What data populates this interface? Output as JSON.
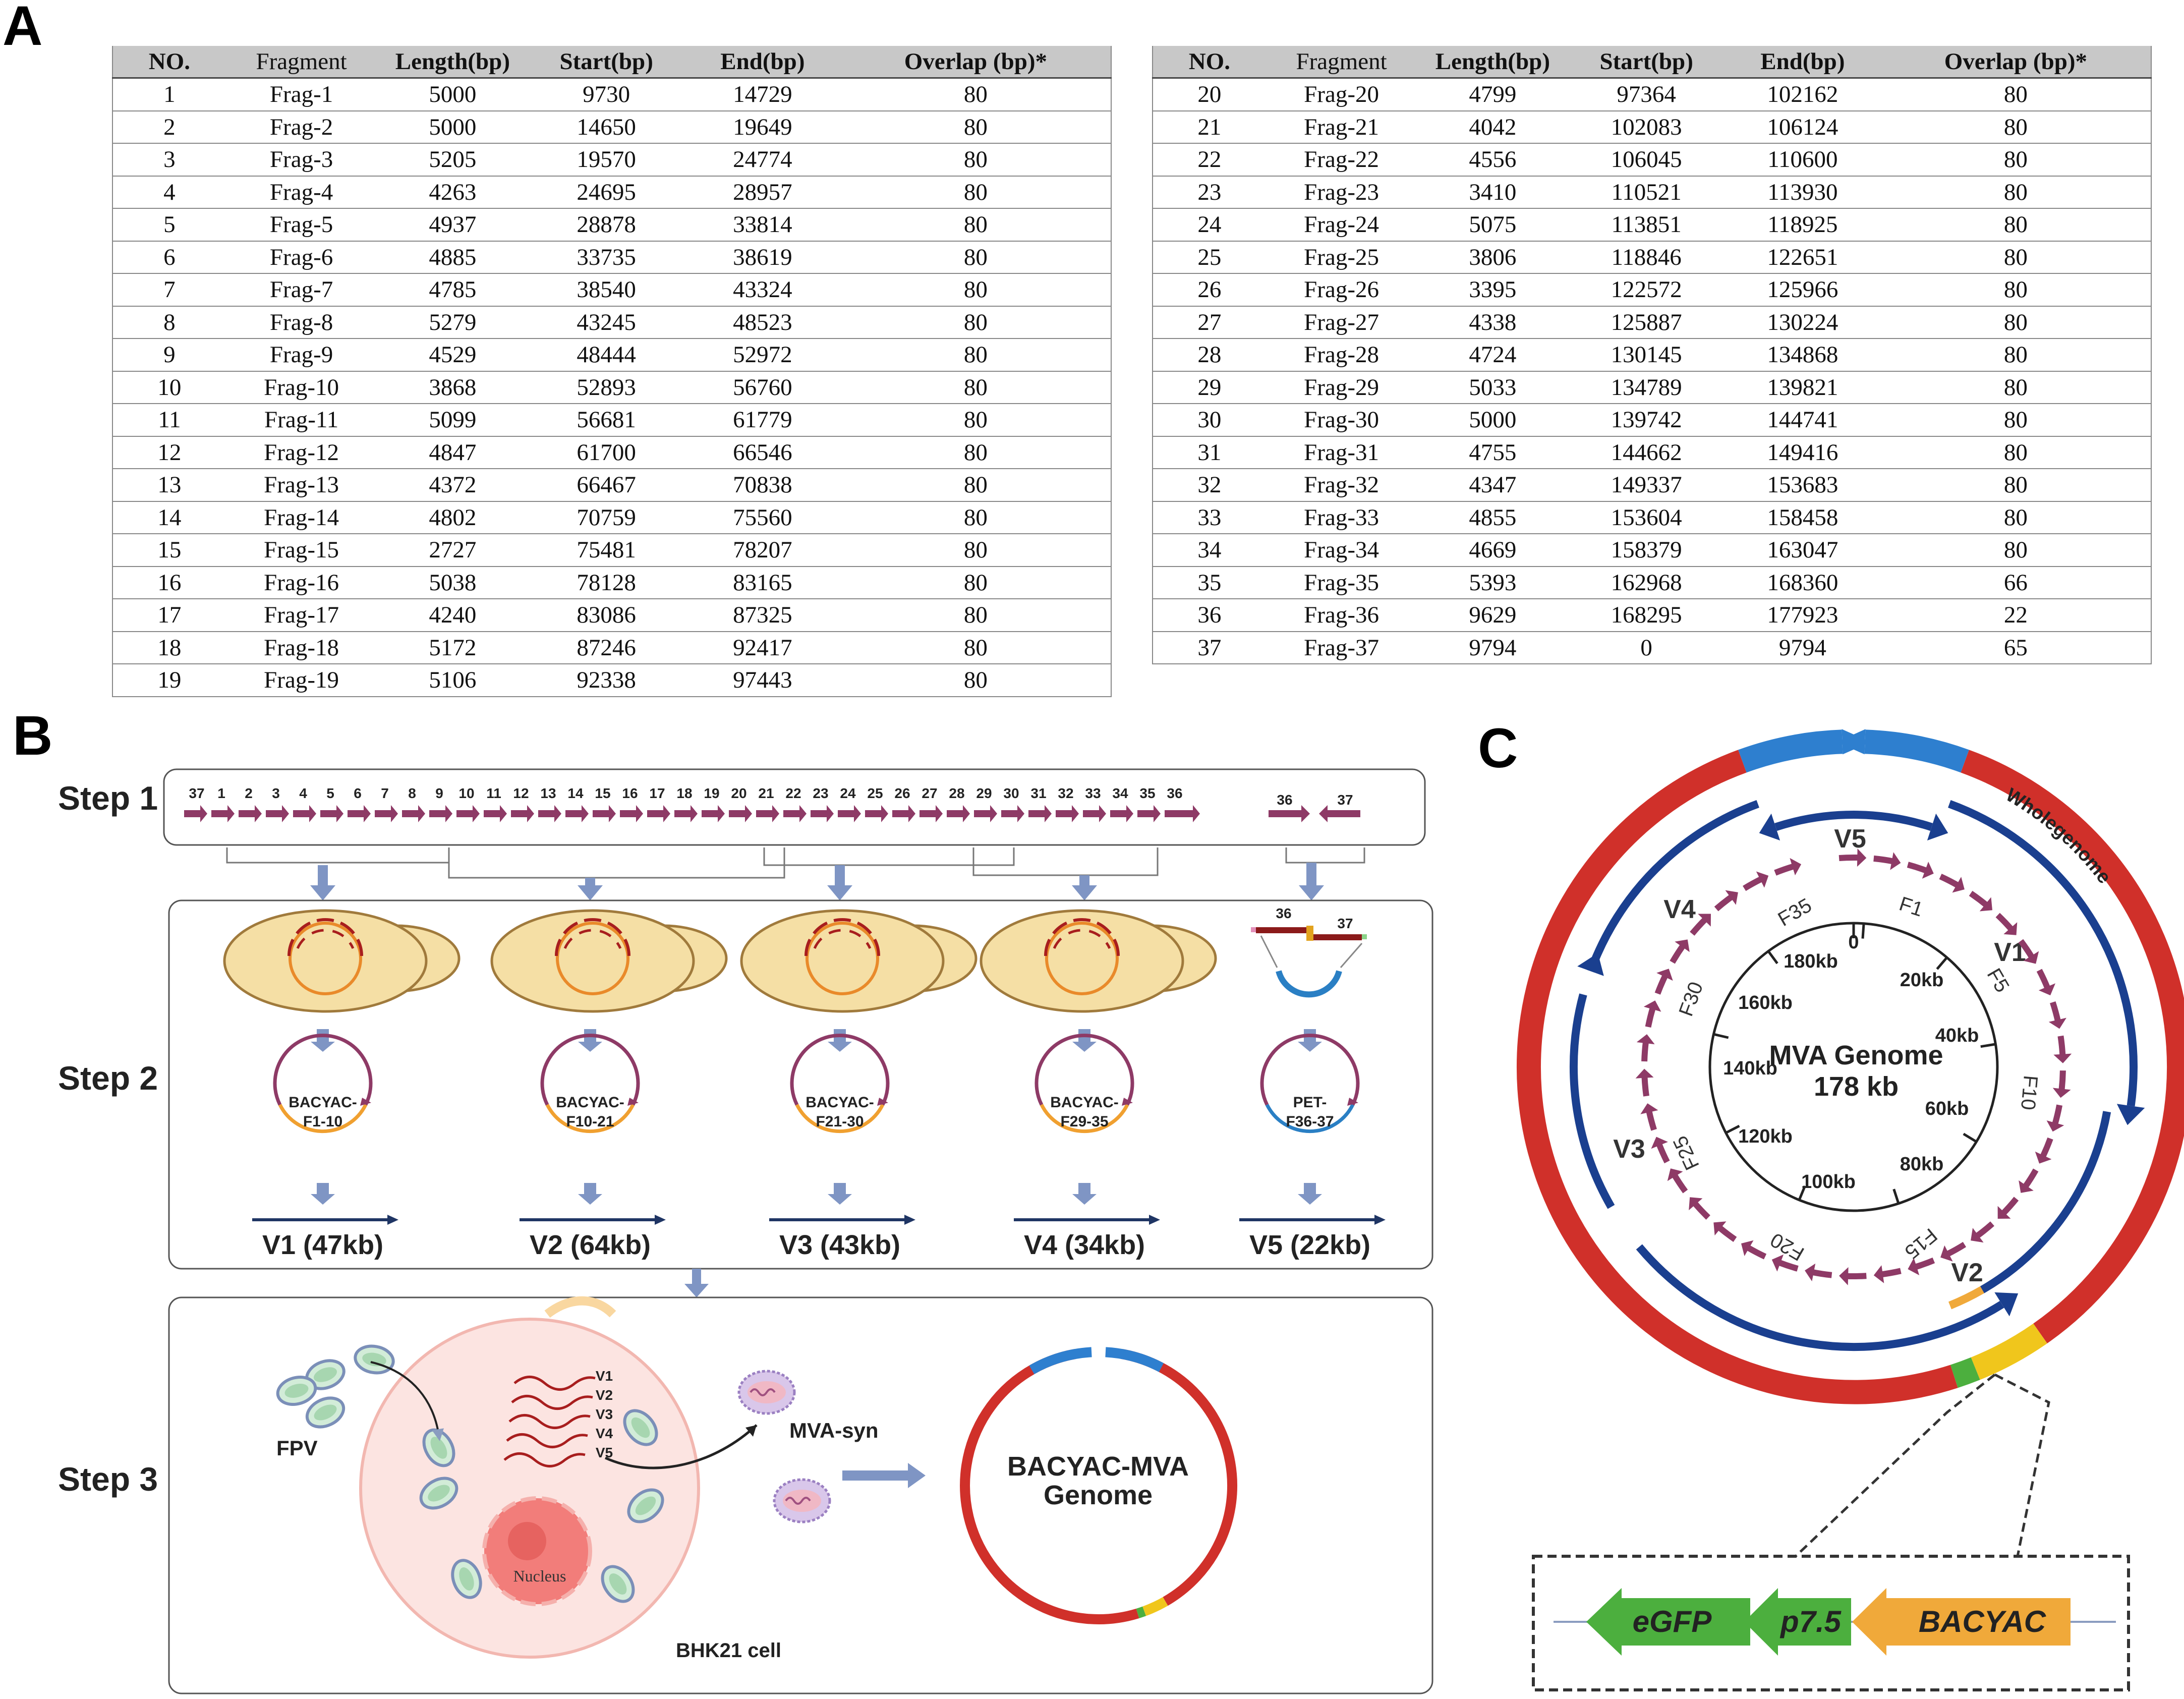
{
  "panels": {
    "a": "A",
    "b": "B",
    "c": "C"
  },
  "table": {
    "headers": [
      "NO.",
      "Fragment",
      "Length(bp)",
      "Start(bp)",
      "End(bp)",
      "Overlap (bp)*"
    ],
    "left_rows": [
      [
        "1",
        "Frag-1",
        "5000",
        "9730",
        "14729",
        "80"
      ],
      [
        "2",
        "Frag-2",
        "5000",
        "14650",
        "19649",
        "80"
      ],
      [
        "3",
        "Frag-3",
        "5205",
        "19570",
        "24774",
        "80"
      ],
      [
        "4",
        "Frag-4",
        "4263",
        "24695",
        "28957",
        "80"
      ],
      [
        "5",
        "Frag-5",
        "4937",
        "28878",
        "33814",
        "80"
      ],
      [
        "6",
        "Frag-6",
        "4885",
        "33735",
        "38619",
        "80"
      ],
      [
        "7",
        "Frag-7",
        "4785",
        "38540",
        "43324",
        "80"
      ],
      [
        "8",
        "Frag-8",
        "5279",
        "43245",
        "48523",
        "80"
      ],
      [
        "9",
        "Frag-9",
        "4529",
        "48444",
        "52972",
        "80"
      ],
      [
        "10",
        "Frag-10",
        "3868",
        "52893",
        "56760",
        "80"
      ],
      [
        "11",
        "Frag-11",
        "5099",
        "56681",
        "61779",
        "80"
      ],
      [
        "12",
        "Frag-12",
        "4847",
        "61700",
        "66546",
        "80"
      ],
      [
        "13",
        "Frag-13",
        "4372",
        "66467",
        "70838",
        "80"
      ],
      [
        "14",
        "Frag-14",
        "4802",
        "70759",
        "75560",
        "80"
      ],
      [
        "15",
        "Frag-15",
        "2727",
        "75481",
        "78207",
        "80"
      ],
      [
        "16",
        "Frag-16",
        "5038",
        "78128",
        "83165",
        "80"
      ],
      [
        "17",
        "Frag-17",
        "4240",
        "83086",
        "87325",
        "80"
      ],
      [
        "18",
        "Frag-18",
        "5172",
        "87246",
        "92417",
        "80"
      ],
      [
        "19",
        "Frag-19",
        "5106",
        "92338",
        "97443",
        "80"
      ]
    ],
    "right_rows": [
      [
        "20",
        "Frag-20",
        "4799",
        "97364",
        "102162",
        "80"
      ],
      [
        "21",
        "Frag-21",
        "4042",
        "102083",
        "106124",
        "80"
      ],
      [
        "22",
        "Frag-22",
        "4556",
        "106045",
        "110600",
        "80"
      ],
      [
        "23",
        "Frag-23",
        "3410",
        "110521",
        "113930",
        "80"
      ],
      [
        "24",
        "Frag-24",
        "5075",
        "113851",
        "118925",
        "80"
      ],
      [
        "25",
        "Frag-25",
        "3806",
        "118846",
        "122651",
        "80"
      ],
      [
        "26",
        "Frag-26",
        "3395",
        "122572",
        "125966",
        "80"
      ],
      [
        "27",
        "Frag-27",
        "4338",
        "125887",
        "130224",
        "80"
      ],
      [
        "28",
        "Frag-28",
        "4724",
        "130145",
        "134868",
        "80"
      ],
      [
        "29",
        "Frag-29",
        "5033",
        "134789",
        "139821",
        "80"
      ],
      [
        "30",
        "Frag-30",
        "5000",
        "139742",
        "144741",
        "80"
      ],
      [
        "31",
        "Frag-31",
        "4755",
        "144662",
        "149416",
        "80"
      ],
      [
        "32",
        "Frag-32",
        "4347",
        "149337",
        "153683",
        "80"
      ],
      [
        "33",
        "Frag-33",
        "4855",
        "153604",
        "158458",
        "80"
      ],
      [
        "34",
        "Frag-34",
        "4669",
        "158379",
        "163047",
        "80"
      ],
      [
        "35",
        "Frag-35",
        "5393",
        "162968",
        "168360",
        "66"
      ],
      [
        "36",
        "Frag-36",
        "9629",
        "168295",
        "177923",
        "22"
      ],
      [
        "37",
        "Frag-37",
        "9794",
        "0",
        "9794",
        "65"
      ]
    ]
  },
  "workflow": {
    "step1": "Step 1",
    "step2": "Step 2",
    "step3": "Step 3",
    "fragment_numbers": [
      "37",
      "1",
      "2",
      "3",
      "4",
      "5",
      "6",
      "7",
      "8",
      "9",
      "10",
      "11",
      "12",
      "13",
      "14",
      "15",
      "16",
      "17",
      "18",
      "19",
      "20",
      "21",
      "22",
      "23",
      "24",
      "25",
      "26",
      "27",
      "28",
      "29",
      "30",
      "31",
      "32",
      "33",
      "34",
      "35",
      "36"
    ],
    "v5_fragments": [
      "36",
      "37"
    ],
    "pet_labels": [
      "36",
      "37"
    ],
    "plasmids": [
      {
        "line1": "BACYAC-",
        "line2": "F1-10",
        "version": "V1 (47kb)"
      },
      {
        "line1": "BACYAC-",
        "line2": "F10-21",
        "version": "V2 (64kb)"
      },
      {
        "line1": "BACYAC-",
        "line2": "F21-30",
        "version": "V3 (43kb)"
      },
      {
        "line1": "BACYAC-",
        "line2": "F29-35",
        "version": "V4 (34kb)"
      },
      {
        "line1": "PET-",
        "line2": "F36-37",
        "version": "V5 (22kb)"
      }
    ],
    "fpv": "FPV",
    "v_labels": [
      "V1",
      "V2",
      "V3",
      "V4",
      "V5"
    ],
    "nucleus": "Nucleus",
    "cell": "BHK21 cell",
    "mva_syn": "MVA-syn",
    "genome_line1": "BACYAC-MVA",
    "genome_line2": "Genome"
  },
  "genome_map": {
    "title_line1": "MVA Genome",
    "title_line2": "178 kb",
    "whole_genome": "Wholegenome",
    "versions": [
      "V1",
      "V2",
      "V3",
      "V4",
      "V5"
    ],
    "fragment_labels": [
      "F1",
      "F5",
      "F10",
      "F15",
      "F20",
      "F25",
      "F30",
      "F35"
    ],
    "ticks": [
      "0",
      "20kb",
      "40kb",
      "60kb",
      "80kb",
      "100kb",
      "120kb",
      "140kb",
      "160kb",
      "180kb"
    ],
    "cassette": [
      "eGFP",
      "p7.5",
      "BACYAC"
    ]
  },
  "colors": {
    "genome_red": "#d0302a",
    "overlap_blue": "#2e7fcf",
    "version_navy": "#1a3f8f",
    "fragment_purple": "#8e3a66",
    "egfp_green": "#4caf3e",
    "bacyac_orange": "#f0a93a",
    "yeast": "#f5dfa5",
    "cell_pink": "#fbe2e0"
  }
}
